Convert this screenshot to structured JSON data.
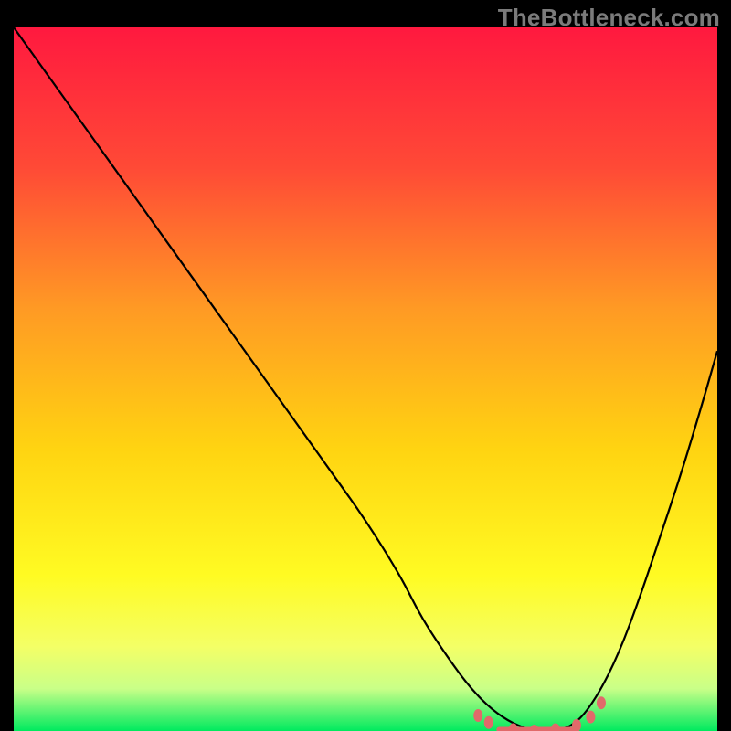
{
  "watermark": "TheBottleneck.com",
  "chart_data": {
    "type": "line",
    "title": "",
    "xlabel": "",
    "ylabel": "",
    "xlim": [
      0,
      100
    ],
    "ylim": [
      0,
      100
    ],
    "grid": false,
    "legend": false,
    "gradient_stops": [
      {
        "offset": 0.0,
        "color": "#ff193f"
      },
      {
        "offset": 0.2,
        "color": "#ff4a36"
      },
      {
        "offset": 0.4,
        "color": "#ff9a24"
      },
      {
        "offset": 0.6,
        "color": "#ffd411"
      },
      {
        "offset": 0.78,
        "color": "#fffb23"
      },
      {
        "offset": 0.88,
        "color": "#f4ff66"
      },
      {
        "offset": 0.94,
        "color": "#c9ff88"
      },
      {
        "offset": 1.0,
        "color": "#00ea5f"
      }
    ],
    "series": [
      {
        "name": "bottleneck-curve",
        "x": [
          0,
          5,
          10,
          15,
          20,
          25,
          30,
          35,
          40,
          45,
          50,
          55,
          58,
          62,
          65,
          68,
          71,
          74,
          77,
          80,
          83,
          86,
          89,
          92,
          95,
          98,
          100
        ],
        "values": [
          100,
          93,
          86,
          79,
          72,
          65,
          58,
          51,
          44,
          37,
          30,
          22,
          16,
          10,
          6,
          3,
          1,
          0,
          0,
          1,
          5,
          11,
          19,
          28,
          37,
          47,
          54
        ]
      }
    ],
    "markers": [
      {
        "x": 66.0,
        "y": 2.2
      },
      {
        "x": 67.5,
        "y": 1.2
      },
      {
        "x": 71.0,
        "y": 0.2
      },
      {
        "x": 74.0,
        "y": 0.0
      },
      {
        "x": 77.0,
        "y": 0.2
      },
      {
        "x": 80.0,
        "y": 0.8
      },
      {
        "x": 82.0,
        "y": 2.0
      },
      {
        "x": 83.5,
        "y": 4.0
      }
    ],
    "marker_segment": {
      "x0": 69.0,
      "x1": 80.0,
      "y": 0.2
    }
  }
}
